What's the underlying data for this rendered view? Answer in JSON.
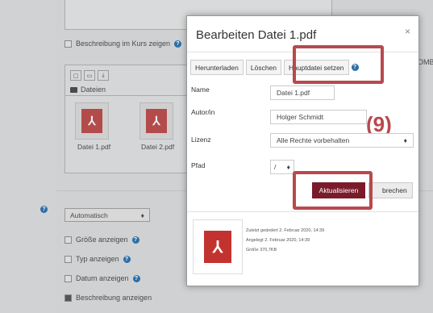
{
  "background": {
    "show_description_label": "Beschreibung im Kurs zeigen",
    "files_header": "Dateien",
    "files": [
      {
        "name": "Datei 1.pdf"
      },
      {
        "name": "Datei 2.pdf"
      }
    ],
    "display_select": "Automatisch",
    "options": [
      {
        "label": "Größe anzeigen",
        "checked": false
      },
      {
        "label": "Typ anzeigen",
        "checked": false
      },
      {
        "label": "Datum anzeigen",
        "checked": false
      },
      {
        "label": "Beschreibung anzeigen",
        "checked": true
      }
    ],
    "edge_text": "OMB"
  },
  "modal": {
    "title": "Bearbeiten Datei 1.pdf",
    "close": "×",
    "buttons": {
      "download": "Herunterladen",
      "delete": "Löschen",
      "set_main": "Hauptdatei setzen"
    },
    "fields": {
      "name_label": "Name",
      "name_value": "Datei 1.pdf",
      "author_label": "Autor/in",
      "author_value": "Holger Schmidt",
      "license_label": "Lizenz",
      "license_value": "Alle Rechte vorbehalten",
      "path_label": "Pfad",
      "path_value": "/"
    },
    "annotation": "(9)",
    "update_button": "Aktualisieren",
    "cancel_button": "brechen",
    "info": {
      "modified": "Zuletzt geändert  2. Februar 2020, 14:39",
      "created": "Angelegt  2. Februar 2020, 14:39",
      "size": "Größe  370,7KB"
    }
  },
  "colors": {
    "annotation_red": "#b8494d",
    "primary_button": "#7a1b2b",
    "pdf_red": "#c2332f",
    "help_blue": "#2a6ea8"
  }
}
